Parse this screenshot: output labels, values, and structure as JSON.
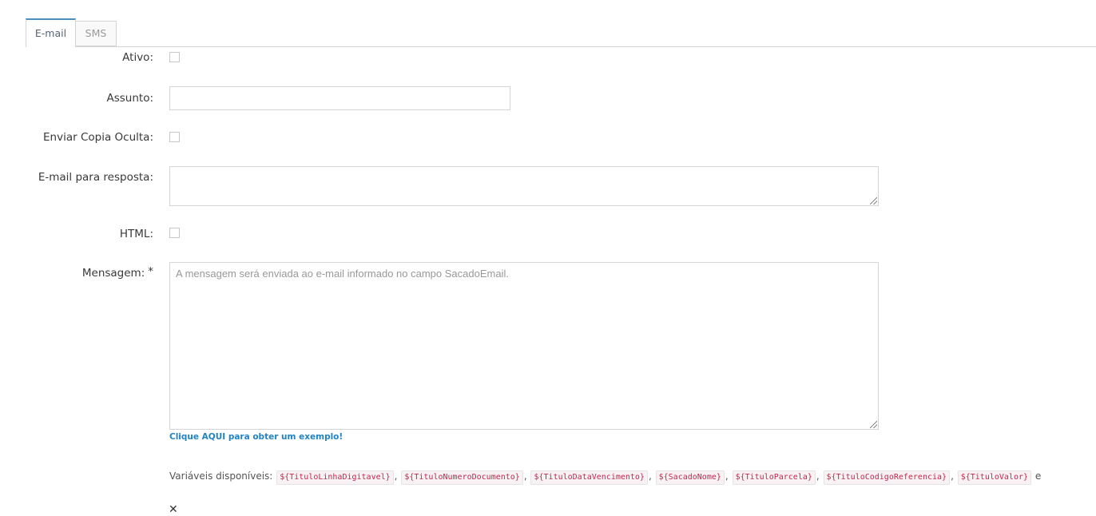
{
  "tabs": [
    {
      "label": "E-mail",
      "active": true
    },
    {
      "label": "SMS",
      "active": false
    }
  ],
  "form": {
    "ativo_label": "Ativo:",
    "assunto_label": "Assunto:",
    "assunto_value": "",
    "copia_oculta_label": "Enviar Copia Oculta:",
    "email_resposta_label": "E-mail para resposta:",
    "email_resposta_value": "",
    "html_label": "HTML:",
    "mensagem_label": "Mensagem:",
    "mensagem_required_mark": "*",
    "mensagem_placeholder": "A mensagem será enviada ao e-mail informado no campo SacadoEmail.",
    "help_link": "Clique AQUI para obter um exemplo!",
    "vars_label": "Variáveis disponíveis:",
    "variables": [
      "${TituloLinhaDigitavel}",
      "${TituloNumeroDocumento}",
      "${TituloDataVencimento}",
      "${SacadoNome}",
      "${TituloParcela}",
      "${TituloCodigoReferencia}",
      "${TituloValor}"
    ],
    "vars_trailing": "e",
    "notify_icon": "close-icon"
  }
}
